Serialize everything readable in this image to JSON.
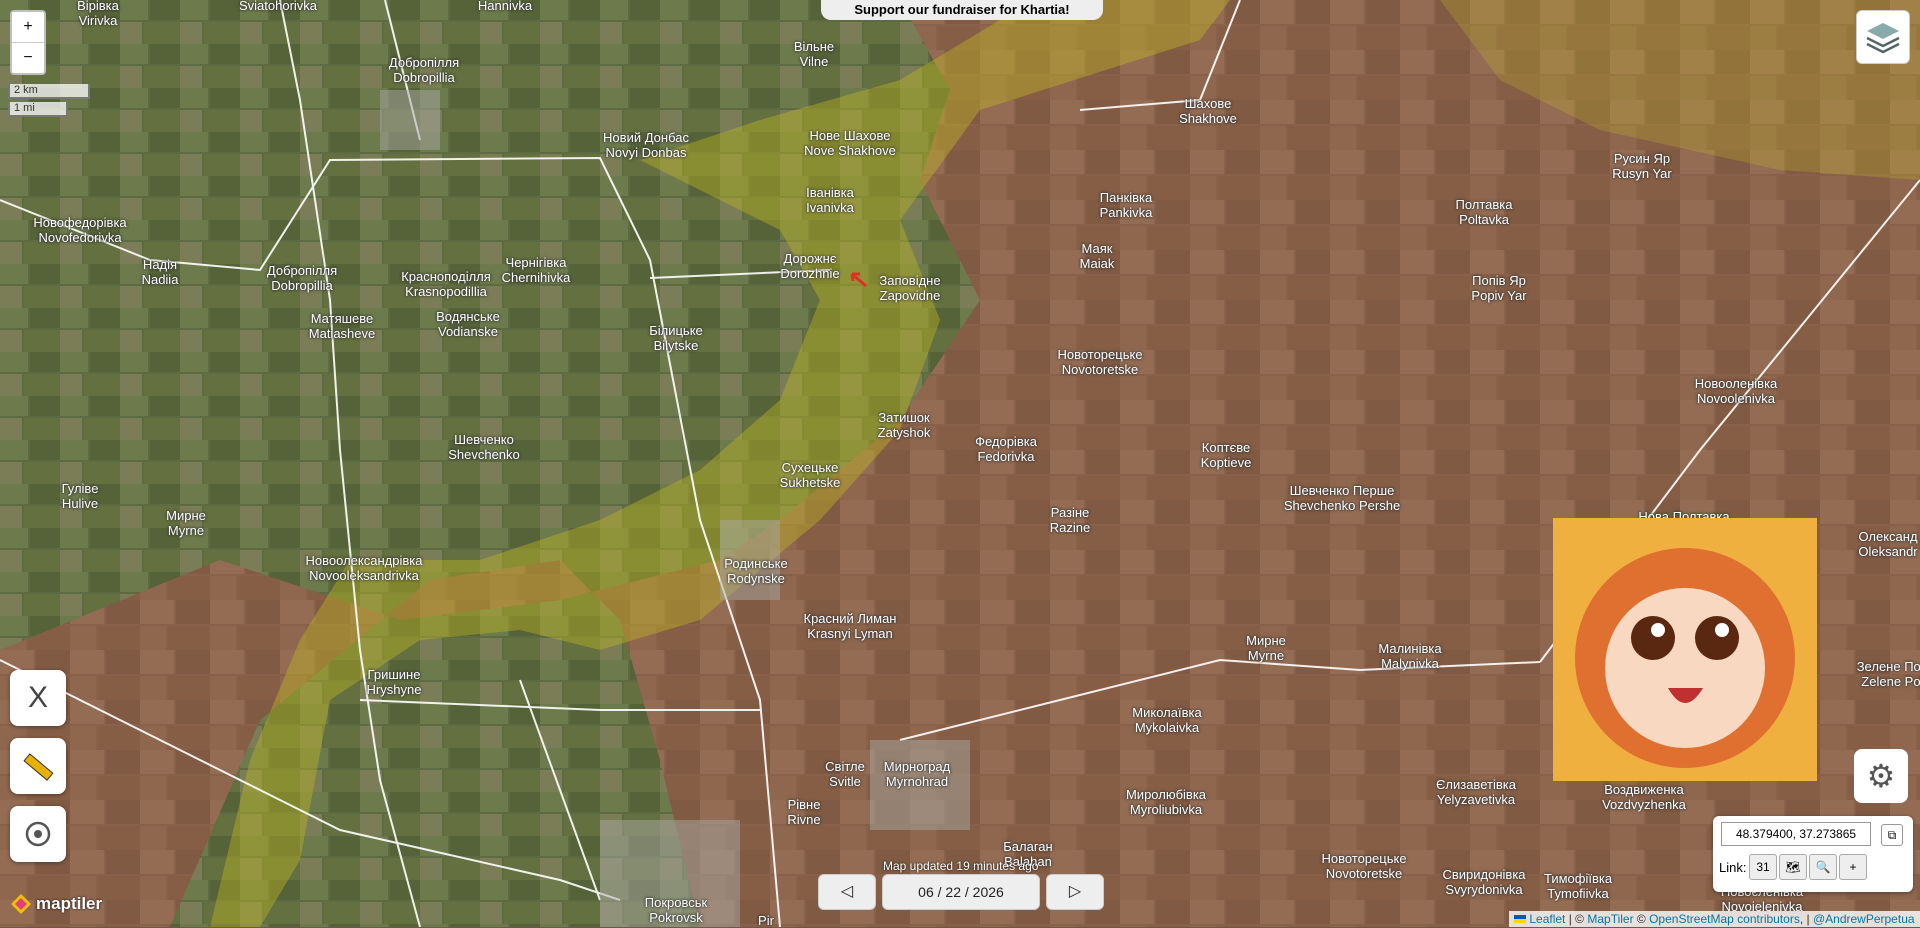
{
  "banner": {
    "text": "Support our fundraiser for Khartia!"
  },
  "zoom": {
    "in": "+",
    "out": "−"
  },
  "scale": {
    "km": "2 km",
    "mi": "1 mi"
  },
  "places": [
    {
      "uk": "Вірівка",
      "en": "Virivka"
    },
    {
      "uk": "Sviatohorivka",
      "en": ""
    },
    {
      "uk": "Hannivka",
      "en": ""
    },
    {
      "uk": "Добропілля",
      "en": "Dobropillia"
    },
    {
      "uk": "Вільне",
      "en": "Vilne"
    },
    {
      "uk": "Новий Донбас",
      "en": "Novyi Donbas"
    },
    {
      "uk": "Нове Шахове",
      "en": "Nove Shakhove"
    },
    {
      "uk": "Шахове",
      "en": "Shakhove"
    },
    {
      "uk": "Русин Яр",
      "en": "Rusyn Yar"
    },
    {
      "uk": "Новофедорівка",
      "en": "Novofedorivka"
    },
    {
      "uk": "Надія",
      "en": "Nadiia"
    },
    {
      "uk": "Добропілля",
      "en": "Dobropillia"
    },
    {
      "uk": "Красноподілля",
      "en": "Krasnopodillia"
    },
    {
      "uk": "Чернігівка",
      "en": "Chernihivka"
    },
    {
      "uk": "Іванівка",
      "en": "Ivanivka"
    },
    {
      "uk": "Дорожнє",
      "en": "Dorozhnie"
    },
    {
      "uk": "Заповідне",
      "en": "Zapovidne"
    },
    {
      "uk": "Панківка",
      "en": "Pankivka"
    },
    {
      "uk": "Маяк",
      "en": "Maiak"
    },
    {
      "uk": "Полтавка",
      "en": "Poltavka"
    },
    {
      "uk": "Попів Яр",
      "en": "Popiv Yar"
    },
    {
      "uk": "Матяшеве",
      "en": "Matiasheve"
    },
    {
      "uk": "Водянське",
      "en": "Vodianske"
    },
    {
      "uk": "Білицьке",
      "en": "Bilytske"
    },
    {
      "uk": "Новоторецьке",
      "en": "Novotoretske"
    },
    {
      "uk": "Новооленівка",
      "en": "Novoolenivka"
    },
    {
      "uk": "Затишок",
      "en": "Zatyshok"
    },
    {
      "uk": "Шевченко",
      "en": "Shevchenko"
    },
    {
      "uk": "Федорівка",
      "en": "Fedorivka"
    },
    {
      "uk": "Коптєве",
      "en": "Koptieve"
    },
    {
      "uk": "Сухецьке",
      "en": "Sukhetske"
    },
    {
      "uk": "Гуліве",
      "en": "Hulive"
    },
    {
      "uk": "Мирне",
      "en": "Myrne"
    },
    {
      "uk": "Шевченко Перше",
      "en": "Shevchenko Pershe"
    },
    {
      "uk": "Разіне",
      "en": "Razine"
    },
    {
      "uk": "Нова Полтавка",
      "en": "Nova Poltavka"
    },
    {
      "uk": "Олександ",
      "en": "Oleksandr"
    },
    {
      "uk": "Новоолександрівка",
      "en": "Novooleksandrivka"
    },
    {
      "uk": "Родинське",
      "en": "Rodynske"
    },
    {
      "uk": "Красний Лиман",
      "en": "Krasnyi Lyman"
    },
    {
      "uk": "Мирне",
      "en": "Myrne"
    },
    {
      "uk": "Малинівка",
      "en": "Malynivka"
    },
    {
      "uk": "Зелене Поле",
      "en": "Zelene Pole"
    },
    {
      "uk": "Гришине",
      "en": "Hryshyne"
    },
    {
      "uk": "Миколаївка",
      "en": "Mykolaivka"
    },
    {
      "uk": "Світле",
      "en": "Svitle"
    },
    {
      "uk": "Мирноград",
      "en": "Myrnohrad"
    },
    {
      "uk": "Воздвиженка",
      "en": "Vozdvyzhenka"
    },
    {
      "uk": "Миролюбівка",
      "en": "Myroliubivka"
    },
    {
      "uk": "Єлизаветівка",
      "en": "Yelyzavetivka"
    },
    {
      "uk": "Рівне",
      "en": "Rivne"
    },
    {
      "uk": "Балаган",
      "en": "Balahan"
    },
    {
      "uk": "Новоторецьке",
      "en": "Novotoretske"
    },
    {
      "uk": "Свиридонівка",
      "en": "Svyrydonivka"
    },
    {
      "uk": "Тимофіївка",
      "en": "Tymofiivka"
    },
    {
      "uk": "Новоєленівка",
      "en": "Novoielenivka"
    },
    {
      "uk": "Покровськ",
      "en": "Pokrovsk"
    },
    {
      "uk": "Pir",
      "en": ""
    }
  ],
  "coords": {
    "value": "48.379400, 37.273865",
    "copy_label": "⧉"
  },
  "link": {
    "label": "Link:",
    "calendar": "31",
    "map": "🗺",
    "search": "🔍",
    "plus": "+"
  },
  "timeline": {
    "updated": "Map updated 19 minutes ago",
    "date": "06 / 22 / 2026",
    "prev": "◁",
    "next": "▷"
  },
  "attribution": {
    "leaflet": "Leaflet",
    "sep": " | © ",
    "maptiler": "MapTiler",
    "copy": " © ",
    "osm": "OpenStreetMap contributors",
    "sep2": ", | ",
    "author": "@AndrewPerpetua"
  },
  "brand": "maptiler",
  "tools": {
    "x": "X"
  },
  "colors": {
    "occupied": "#b05a3c",
    "contested": "#c8c020",
    "road": "#ffffff"
  }
}
